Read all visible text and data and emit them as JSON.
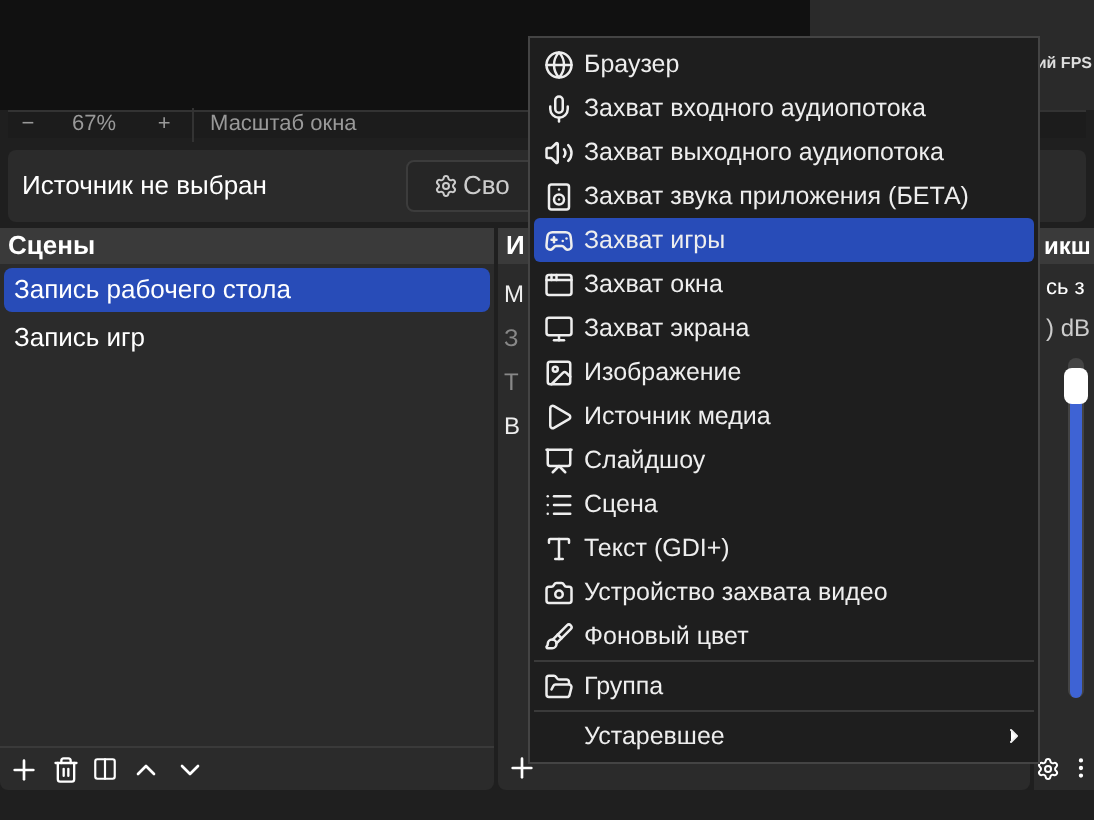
{
  "preview": {
    "zoom_out": "−",
    "zoom": "67%",
    "zoom_in": "+",
    "scale_label": "Масштаб окна",
    "stats_tab": "ий FPS"
  },
  "context_bar": {
    "message": "Источник не выбран",
    "properties_button": "Сво"
  },
  "scenes": {
    "title": "Сцены",
    "items": [
      {
        "label": "Запись рабочего стола",
        "selected": true
      },
      {
        "label": "Запись игр",
        "selected": false
      }
    ]
  },
  "sources": {
    "title": "И",
    "items": [
      {
        "label": "М",
        "visible": true
      },
      {
        "label": "З",
        "visible": false
      },
      {
        "label": "Т",
        "visible": false
      },
      {
        "label": "В",
        "visible": true
      }
    ]
  },
  "mixer": {
    "title": "икш",
    "channel_name": "сь з",
    "reading": ") dB",
    "level": 0.97
  },
  "add_source_menu": {
    "items": [
      {
        "label": "Браузер",
        "selected": false
      },
      {
        "label": "Захват входного аудиопотока",
        "selected": false
      },
      {
        "label": "Захват выходного аудиопотока",
        "selected": false
      },
      {
        "label": "Захват звука приложения (БЕТА)",
        "selected": false
      },
      {
        "label": "Захват игры",
        "selected": true
      },
      {
        "label": "Захват окна",
        "selected": false
      },
      {
        "label": "Захват экрана",
        "selected": false
      },
      {
        "label": "Изображение",
        "selected": false
      },
      {
        "label": "Источник медиа",
        "selected": false
      },
      {
        "label": "Слайдшоу",
        "selected": false
      },
      {
        "label": "Сцена",
        "selected": false
      },
      {
        "label": "Текст (GDI+)",
        "selected": false
      },
      {
        "label": "Устройство захвата видео",
        "selected": false
      },
      {
        "label": "Фоновый цвет",
        "selected": false
      },
      {
        "label": "Группа",
        "selected": false,
        "separator_before": true
      },
      {
        "label": "Устаревшее",
        "selected": false,
        "separator_before": true,
        "submenu": true
      }
    ]
  }
}
